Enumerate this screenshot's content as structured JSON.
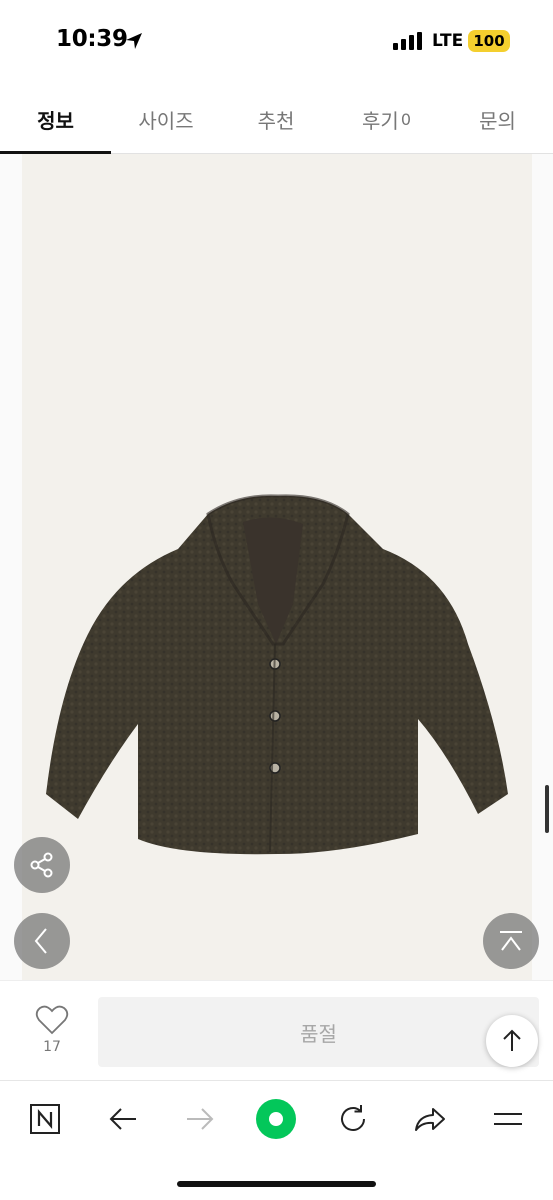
{
  "status_bar": {
    "time": "10:39",
    "network": "LTE",
    "battery": "100",
    "battery_color": "#f4cf2e"
  },
  "tabs": [
    {
      "label": "정보",
      "active": true
    },
    {
      "label": "사이즈",
      "active": false
    },
    {
      "label": "추천",
      "active": false
    },
    {
      "label": "후기",
      "count": "0",
      "active": false
    },
    {
      "label": "문의",
      "active": false
    }
  ],
  "product": {
    "image": "brown-fleece-shawl-collar-jacket",
    "image_bg": "#f3f1ec"
  },
  "floating_buttons": {
    "share": "share-icon",
    "prev": "chevron-left-icon",
    "top": "scroll-top-icon"
  },
  "purchase_bar": {
    "like_count": "17",
    "soldout_label": "품절"
  },
  "browser_toolbar": {
    "icons": [
      "naver-n-icon",
      "back-arrow-icon",
      "forward-arrow-icon",
      "green-dot-icon",
      "reload-icon",
      "share-arrow-icon",
      "menu-icon"
    ],
    "accent": "#03c75a"
  }
}
